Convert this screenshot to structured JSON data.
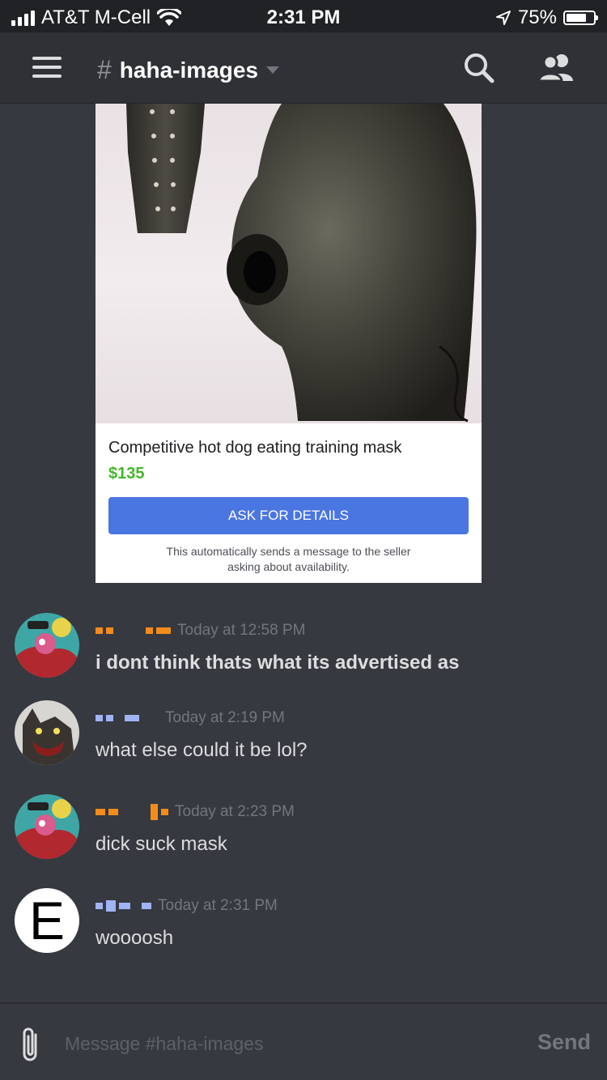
{
  "status_bar": {
    "carrier": "AT&T M-Cell",
    "time": "2:31 PM",
    "battery_percent": "75%",
    "battery_level": 0.75,
    "icons": [
      "signal-icon",
      "wifi-icon",
      "location-arrow-icon",
      "battery-icon"
    ]
  },
  "header": {
    "hash": "#",
    "channel_name": "haha-images",
    "icons": [
      "hamburger-icon",
      "chevron-down-icon",
      "search-icon",
      "members-icon"
    ]
  },
  "embed": {
    "title": "Competitive hot dog eating training mask",
    "price": "$135",
    "button_label": "ASK FOR DETAILS",
    "note_line1": "This automatically sends a message to the seller",
    "note_line2": "asking about availability.",
    "colors": {
      "price": "#42b72a",
      "button": "#4a76e2"
    }
  },
  "messages": [
    {
      "timestamp": "Today at 12:58 PM",
      "text": "i dont think thats what its advertised as",
      "bold": true,
      "avatar": "cartoon-avatar",
      "name_color": "#f48c1c"
    },
    {
      "timestamp": "Today at 2:19 PM",
      "text": "what else could it be lol?",
      "bold": false,
      "avatar": "hyena-avatar",
      "name_color": "#9fb3f5"
    },
    {
      "timestamp": "Today at 2:23 PM",
      "text": "dick suck mask",
      "bold": false,
      "avatar": "cartoon-avatar",
      "name_color": "#f48c1c"
    },
    {
      "timestamp": "Today at 2:31 PM",
      "text": "woooosh",
      "bold": false,
      "avatar": "letter-avatar",
      "avatar_letter": "E",
      "name_color": "#9fb3f5"
    }
  ],
  "composer": {
    "placeholder": "Message #haha-images",
    "send_label": "Send",
    "icons": [
      "paperclip-icon"
    ]
  },
  "colors": {
    "background": "#36393f",
    "header": "#2f3136",
    "status_bar": "#202225",
    "timestamp": "#72767d"
  }
}
